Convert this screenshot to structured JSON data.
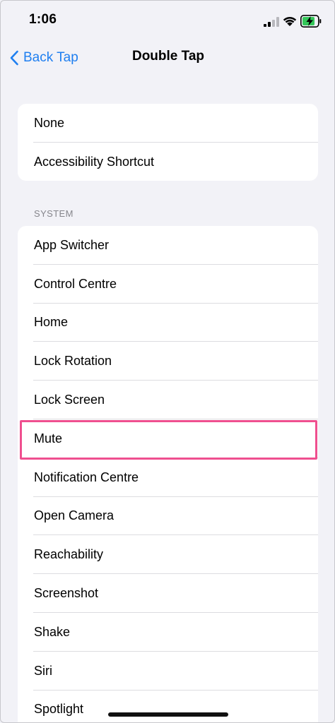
{
  "status_bar": {
    "time": "1:06",
    "battery_color": "#34c759"
  },
  "nav": {
    "back_label": "Back Tap",
    "title": "Double Tap",
    "accent_color": "#1f7ff0"
  },
  "top_options": [
    {
      "label": "None"
    },
    {
      "label": "Accessibility Shortcut"
    }
  ],
  "system_section": {
    "header": "SYSTEM",
    "items": [
      {
        "label": "App Switcher"
      },
      {
        "label": "Control Centre"
      },
      {
        "label": "Home"
      },
      {
        "label": "Lock Rotation"
      },
      {
        "label": "Lock Screen"
      },
      {
        "label": "Mute",
        "highlighted": true
      },
      {
        "label": "Notification Centre"
      },
      {
        "label": "Open Camera"
      },
      {
        "label": "Reachability"
      },
      {
        "label": "Screenshot"
      },
      {
        "label": "Shake"
      },
      {
        "label": "Siri"
      },
      {
        "label": "Spotlight"
      }
    ]
  },
  "highlight_color": "#ef4f8f"
}
